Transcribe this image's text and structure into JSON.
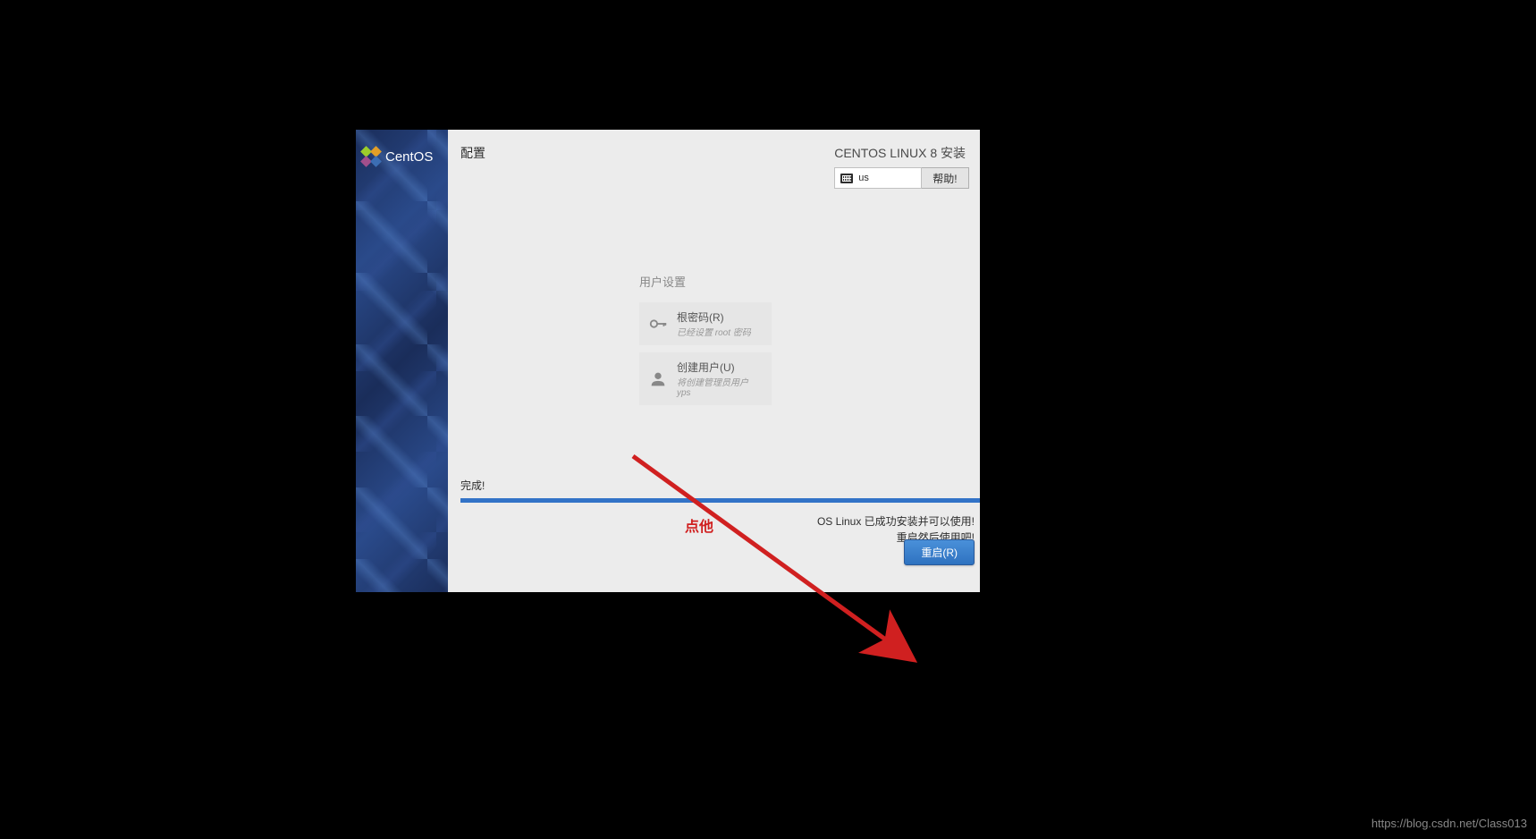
{
  "sidebar": {
    "brand": "CentOS"
  },
  "header": {
    "page_title": "配置",
    "install_title": "CENTOS LINUX 8 安装",
    "lang_code": "us",
    "help_label": "帮助!"
  },
  "user_settings": {
    "heading": "用户设置",
    "root_password": {
      "title": "根密码(R)",
      "subtitle": "已经设置 root 密码"
    },
    "create_user": {
      "title": "创建用户(U)",
      "subtitle": "将创建管理员用户 yps"
    }
  },
  "progress": {
    "label": "完成!",
    "finish_line1": "OS Linux 已成功安装并可以使用!",
    "finish_line2": "重启然后使用吧!",
    "reboot_label": "重启(R)"
  },
  "annotation": {
    "text": "点他"
  },
  "watermark": "https://blog.csdn.net/Class013"
}
